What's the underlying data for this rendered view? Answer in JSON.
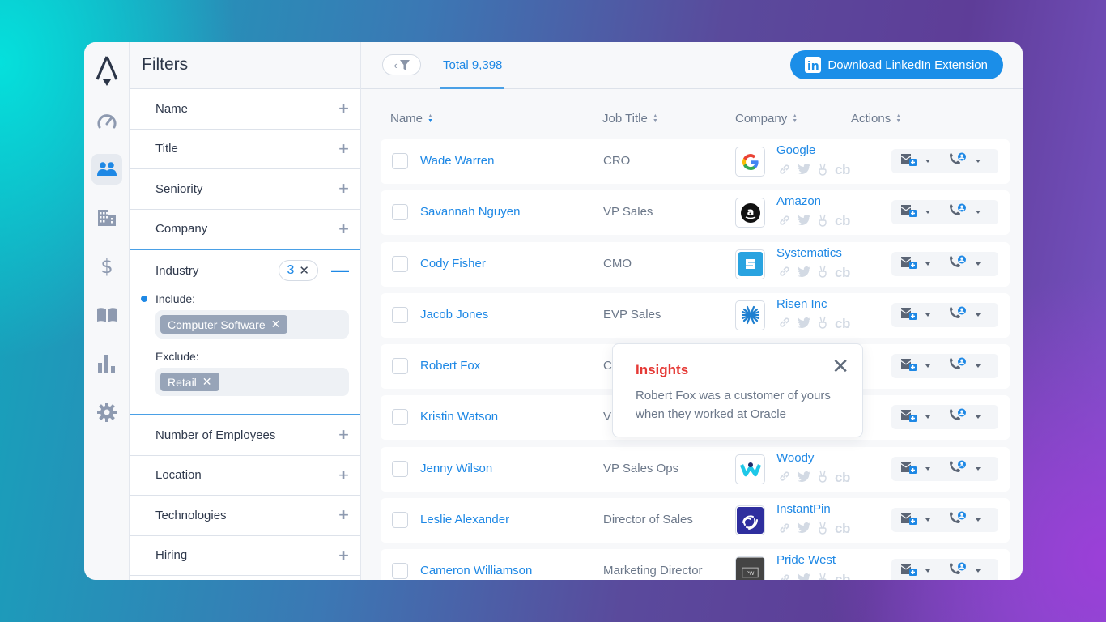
{
  "rail": {
    "items": [
      {
        "icon": "dashboard-gauge-icon",
        "active": false
      },
      {
        "icon": "people-icon",
        "active": true
      },
      {
        "icon": "building-icon",
        "active": false
      },
      {
        "icon": "dollar-icon",
        "active": false
      },
      {
        "icon": "book-icon",
        "active": false
      },
      {
        "icon": "bar-chart-icon",
        "active": false
      },
      {
        "icon": "gear-icon",
        "active": false
      }
    ]
  },
  "filters": {
    "title": "Filters",
    "items_before": [
      "Name",
      "Title",
      "Seniority",
      "Company"
    ],
    "industry": {
      "label": "Industry",
      "count": "3",
      "include_label": "Include:",
      "include_chips": [
        "Computer Software"
      ],
      "exclude_label": "Exclude:",
      "exclude_chips": [
        "Retail"
      ]
    },
    "items_after": [
      "Number of Employees",
      "Location",
      "Technologies",
      "Hiring"
    ]
  },
  "topbar": {
    "total_label": "Total 9,398",
    "linkedin_button": "Download LinkedIn Extension",
    "linkedin_icon_text": "in"
  },
  "table": {
    "columns": [
      "Name",
      "Job Title",
      "Company",
      "Actions"
    ],
    "sorted_column": "Name",
    "social_cb": "cb",
    "rows": [
      {
        "name": "Wade Warren",
        "title": "CRO",
        "company": "Google",
        "logo": "google"
      },
      {
        "name": "Savannah Nguyen",
        "title": "VP Sales",
        "company": "Amazon",
        "logo": "amazon"
      },
      {
        "name": "Cody Fisher",
        "title": "CMO",
        "company": "Systematics",
        "logo": "systematics"
      },
      {
        "name": "Jacob Jones",
        "title": "EVP Sales",
        "company": "Risen Inc",
        "logo": "risen"
      },
      {
        "name": "Robert Fox",
        "title": "C",
        "company": "",
        "logo": ""
      },
      {
        "name": "Kristin Watson",
        "title": "VI",
        "company": "",
        "logo": ""
      },
      {
        "name": "Jenny Wilson",
        "title": "VP Sales Ops",
        "company": "Woody",
        "logo": "woody"
      },
      {
        "name": "Leslie Alexander",
        "title": "Director of Sales",
        "company": "InstantPin",
        "logo": "instantpin"
      },
      {
        "name": "Cameron Williamson",
        "title": "Marketing Director",
        "company": "Pride West",
        "logo": "pridewest"
      }
    ]
  },
  "insight": {
    "title": "Insights",
    "body": "Robert Fox was a customer of yours when they worked at Oracle",
    "close_icon": "close-icon"
  },
  "colors": {
    "accent": "#1e88e5",
    "insight_title": "#e53935",
    "chip": "#97a4b8"
  }
}
